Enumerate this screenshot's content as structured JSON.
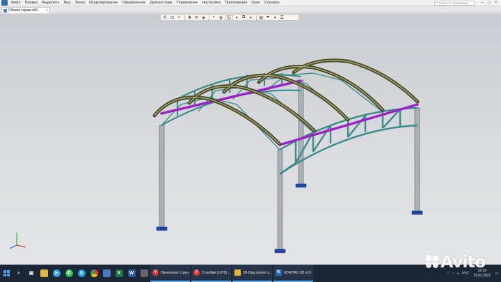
{
  "menubar": {
    "items": [
      "Файл",
      "Правка",
      "Выделить",
      "Вид",
      "Эскиз",
      "Моделирование",
      "Оформление",
      "Диагностика",
      "Управление",
      "Настройка",
      "Приложения",
      "Окно",
      "Справка"
    ],
    "search_placeholder": "Поиск по командам (Alt+/)"
  },
  "tabs": [
    {
      "label": "Сборка гараж.a3d"
    }
  ],
  "view_toolbar": {
    "zoom_value": "Ко"
  },
  "taskbar": {
    "apps": [
      {
        "label": "Начальная стран...",
        "icon": "yandex-icon",
        "color": "#e8372c"
      },
      {
        "label": "О любви (1970) ...",
        "icon": "yandex-icon",
        "color": "#e8372c"
      },
      {
        "label": "3D-Вид проект н...",
        "icon": "folder-icon",
        "color": "#e7b53c"
      },
      {
        "label": "КОМПАС-3D v19",
        "icon": "kompas-icon",
        "color": "#2b6cb3"
      }
    ],
    "tray": {
      "language": "РУС",
      "time": "12:19",
      "date": "19.03.2021"
    }
  },
  "watermark": "Avito",
  "colors": {
    "arch": "#4b4a25",
    "purlin": "#a020c8",
    "frame": "#3c8b8b",
    "column": "#a9b0b6",
    "base": "#1f46a8"
  }
}
